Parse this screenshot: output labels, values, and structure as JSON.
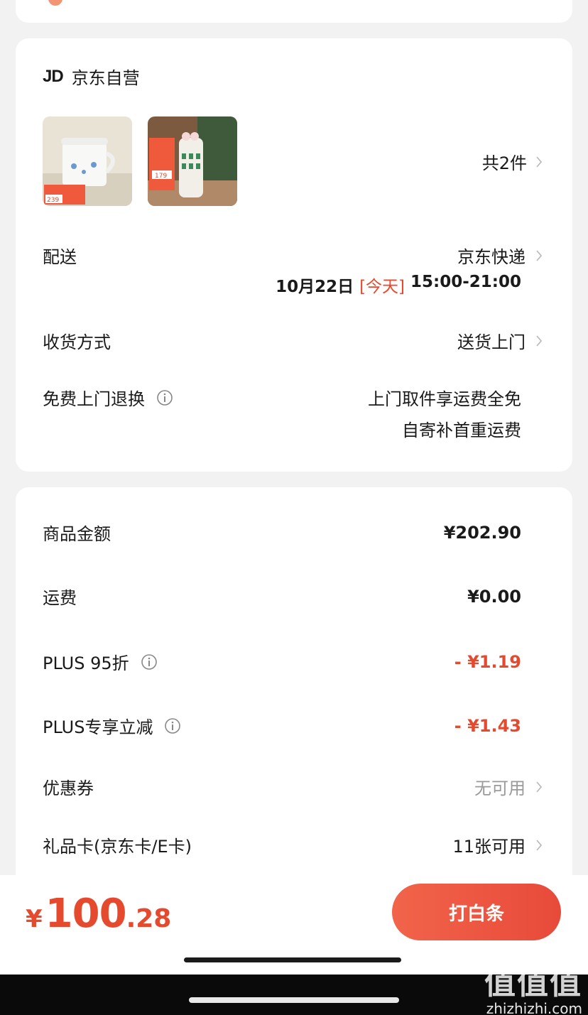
{
  "colors": {
    "accent": "#e64a2e",
    "muted": "#9a9a9a",
    "card": "#ffffff",
    "background": "#f2f2f2"
  },
  "shop": {
    "logo": "JD",
    "name": "京东自营"
  },
  "products": {
    "count_label": "共2件",
    "thumb1_price": "239",
    "thumb2_price": "179"
  },
  "delivery": {
    "label": "配送",
    "carrier": "京东快递",
    "date": "10月22日",
    "today": "[今天]",
    "time": "15:00-21:00"
  },
  "receive": {
    "label": "收货方式",
    "value": "送货上门"
  },
  "free_return": {
    "label": "免费上门退换",
    "line1": "上门取件享运费全免",
    "line2": "自寄补首重运费"
  },
  "costs": {
    "goods_label": "商品金额",
    "goods_value": "¥202.90",
    "shipping_label": "运费",
    "shipping_value": "¥0.00",
    "plus95_label": "PLUS 95折",
    "plus95_value": "- ¥1.19",
    "plus_cut_label": "PLUS专享立减",
    "plus_cut_value": "- ¥1.43",
    "coupon_label": "优惠券",
    "coupon_value": "无可用",
    "giftcard_label": "礼品卡(京东卡/E卡)",
    "giftcard_value": "11张可用"
  },
  "footer": {
    "currency": "¥",
    "total_int": "100",
    "total_dec": ".28",
    "pay_label": "打白条"
  },
  "watermark": {
    "logo": "值值值",
    "url": "zhizhizhi.com"
  }
}
